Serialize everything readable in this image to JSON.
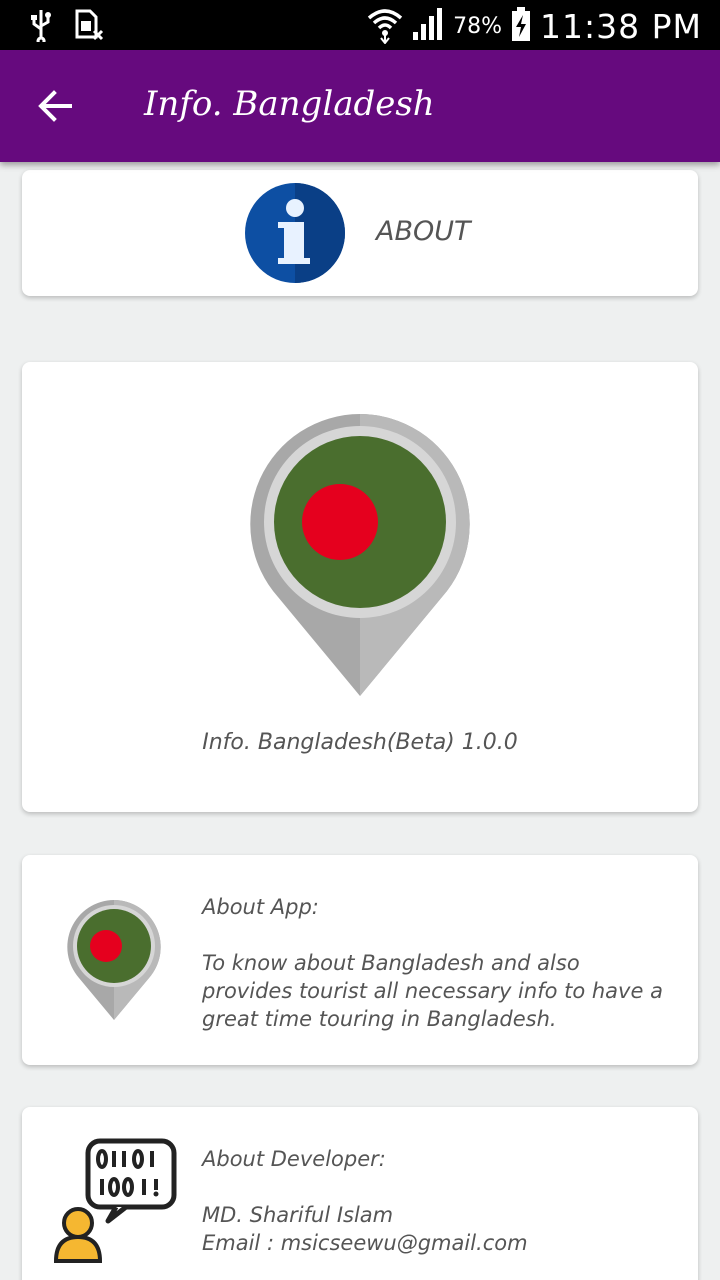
{
  "status_bar": {
    "icons": [
      "usb-icon",
      "no-sim-icon",
      "wifi-icon",
      "signal-icon",
      "battery-charging-icon"
    ],
    "battery": "78%",
    "time": "11:38 PM"
  },
  "app_bar": {
    "back_icon": "arrow-back-icon",
    "title": "Info. Bangladesh"
  },
  "about_card": {
    "icon": "info-icon",
    "label": "ABOUT"
  },
  "logo_card": {
    "icon": "bangladesh-map-pin-icon",
    "version_text": "Info. Bangladesh(Beta) 1.0.0"
  },
  "app_card": {
    "icon": "bangladesh-map-pin-icon",
    "heading": "About App:",
    "description": "To know about Bangladesh and also provides tourist all necessary info to have a great time touring in Bangladesh."
  },
  "developer_card": {
    "icon": "developer-binary-icon",
    "heading": "About Developer:",
    "name": "MD. Shariful Islam",
    "email": "Email : msicseewu@gmail.com"
  },
  "colors": {
    "app_bar": "#660a7e",
    "flag_green": "#4a6e2e",
    "flag_red": "#e5001e",
    "info_blue": "#0d4fa3"
  }
}
